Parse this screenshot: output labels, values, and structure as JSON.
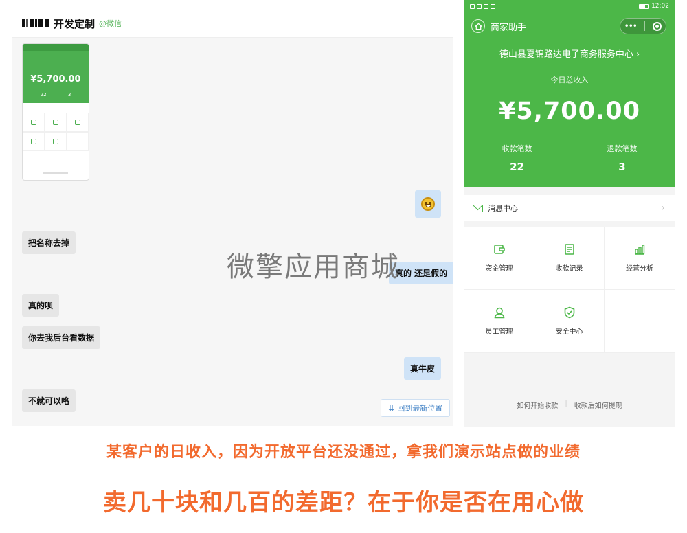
{
  "chat": {
    "title": "开发定制",
    "tag": "@微信",
    "thumb": {
      "amount": "¥5,700.00",
      "left_num": "22",
      "right_num": "3"
    },
    "messages": [
      {
        "side": "left",
        "text": "把名称去掉"
      },
      {
        "side": "right",
        "text": "真的 还是假的"
      },
      {
        "side": "left",
        "text": "真的呗"
      },
      {
        "side": "left",
        "text": "你去我后台看数据"
      },
      {
        "side": "right",
        "text": "真牛皮"
      },
      {
        "side": "left",
        "text": "不就可以咯"
      }
    ],
    "jump_button": "回到最新位置"
  },
  "watermark": "微擎应用商城",
  "phone": {
    "status_time": "12:02",
    "nav_title": "商家助手",
    "merchant": "德山县夏锦路达电子商务服务中心",
    "income_label": "今日总收入",
    "income_amount": "¥5,700.00",
    "stats": [
      {
        "label": "收款笔数",
        "value": "22"
      },
      {
        "label": "退款笔数",
        "value": "3"
      }
    ],
    "message_center": "消息中心",
    "grid": [
      {
        "label": "资金管理",
        "icon": "wallet-icon"
      },
      {
        "label": "收款记录",
        "icon": "record-icon"
      },
      {
        "label": "经营分析",
        "icon": "chart-icon"
      },
      {
        "label": "员工管理",
        "icon": "staff-icon"
      },
      {
        "label": "安全中心",
        "icon": "shield-icon"
      }
    ],
    "links": [
      "如何开始收款",
      "收款后如何提现"
    ],
    "accent_color": "#4cb748"
  },
  "captions": {
    "line1": "某客户的日收入，因为开放平台还没通过，拿我们演示站点做的业绩",
    "line2": "卖几十块和几百的差距？在于你是否在用心做",
    "color": "#f26a2e"
  }
}
